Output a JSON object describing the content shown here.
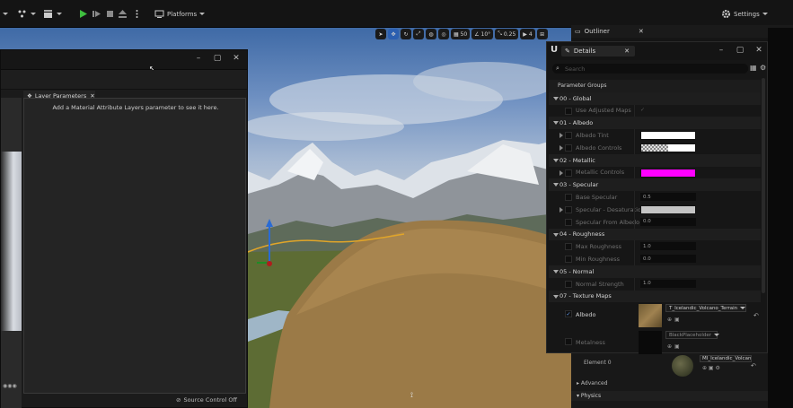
{
  "toolbar": {
    "mode_label": "Platforms",
    "settings_label": "Settings"
  },
  "viewport_toolbar": {
    "grid_snap": "50",
    "angle_snap": "10°",
    "scale_snap": "0.25",
    "camera_speed": "4"
  },
  "material_editor": {
    "layer_tab_label": "Layer Parameters",
    "layer_message": "Add a Material Attribute Layers parameter to see it here.",
    "source_control": "Source Control Off"
  },
  "outliner": {
    "tab_label": "Outliner"
  },
  "details": {
    "tab_label": "Details",
    "search_placeholder": "Search",
    "section_header": "Parameter Groups",
    "groups": [
      {
        "label": "00 - Global"
      },
      {
        "label": "01 - Albedo"
      },
      {
        "label": "02 - Metallic"
      },
      {
        "label": "03 - Specular"
      },
      {
        "label": "04 - Roughness"
      },
      {
        "label": "05 - Normal"
      },
      {
        "label": "07 - Texture Maps"
      }
    ],
    "props": {
      "use_adjusted_maps": "Use Adjusted Maps",
      "albedo_tint": "Albedo Tint",
      "albedo_controls": "Albedo Controls",
      "metallic_controls": "Metallic Controls",
      "base_specular": "Base Specular",
      "base_specular_value": "0.5",
      "specular_desaturation": "Specular - Desaturation",
      "specular_from_albedo": "Specular From Albedo",
      "specular_from_albedo_value": "0.0",
      "max_roughness": "Max Roughness",
      "max_roughness_value": "1.0",
      "min_roughness": "Min Roughness",
      "min_roughness_value": "0.0",
      "normal_strength": "Normal Strength",
      "normal_strength_value": "1.0",
      "albedo_label": "Albedo",
      "albedo_asset": "T_Icelandic_Volcano_Terrain_",
      "metalness_label": "Metalness",
      "metalness_asset": "BlackPlaceholder"
    },
    "colors": {
      "albedo_tint": "#ffffff",
      "metallic_controls": "#ff00ff",
      "specular_desaturation": "#c4c4c4"
    }
  },
  "lower_details": {
    "element_label": "Element 0",
    "material_asset": "MI_Icelandic_Volcan",
    "advanced_label": "Advanced",
    "physics_label": "Physics"
  }
}
